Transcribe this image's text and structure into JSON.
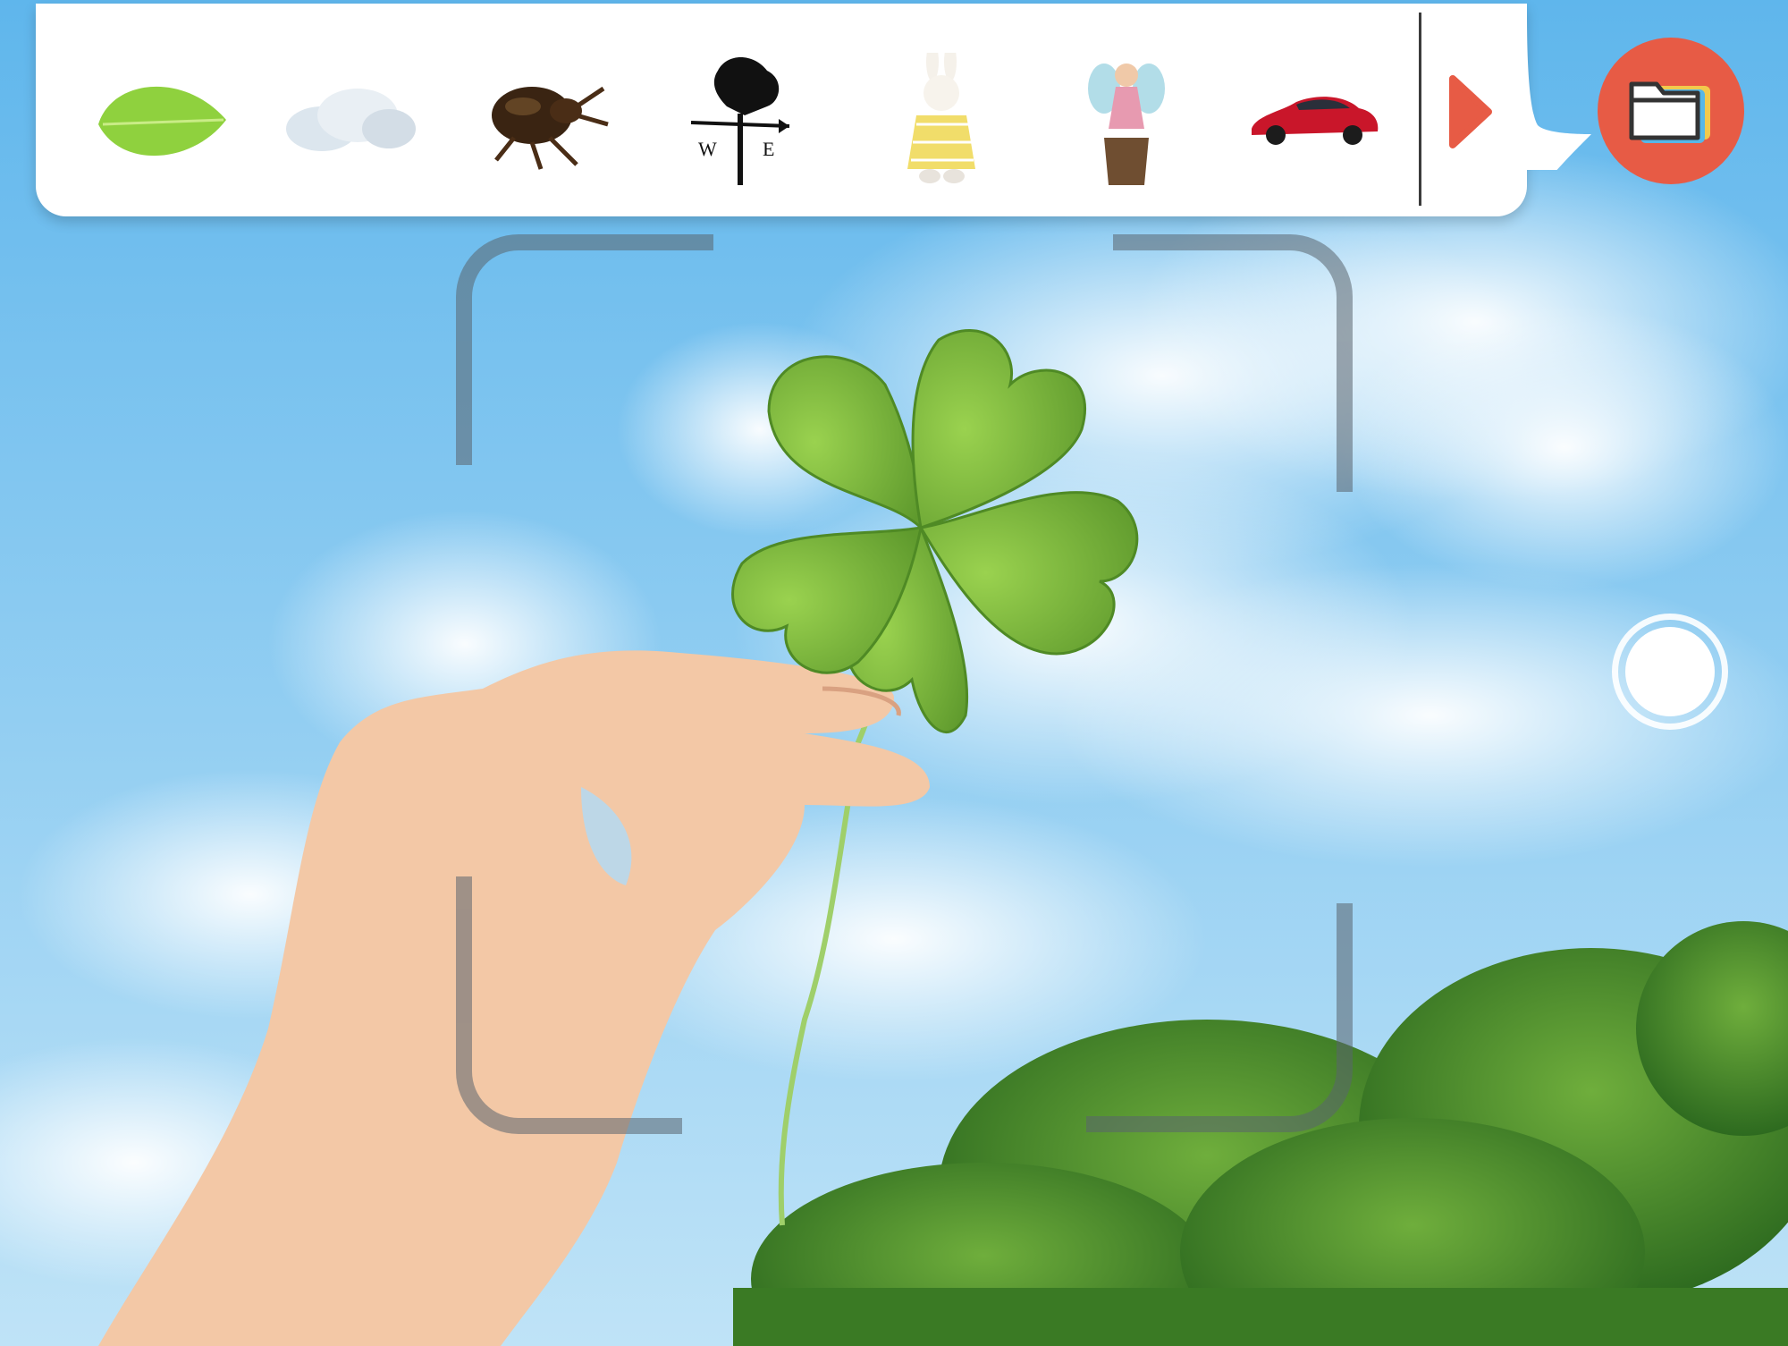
{
  "scene": {
    "description_icon": "four-leaf-clover-photo",
    "sky_top": "#5fb6ec",
    "sky_bottom": "#bfe3f7"
  },
  "tray": {
    "items": [
      {
        "name": "leaf-thumbnail-icon"
      },
      {
        "name": "cloud-thumbnail-icon"
      },
      {
        "name": "beetle-thumbnail-icon"
      },
      {
        "name": "weathervane-thumbnail-icon"
      },
      {
        "name": "rabbit-figurine-thumbnail-icon"
      },
      {
        "name": "fairy-figurine-thumbnail-icon"
      },
      {
        "name": "red-car-thumbnail-icon"
      }
    ],
    "next_icon": "play-arrow-icon",
    "accent": "#e75b45"
  },
  "gallery_button": {
    "icon": "folder-icon",
    "color": "#e75b45"
  },
  "shutter_button": {
    "icon": "shutter-circle-icon"
  },
  "weathervane": {
    "w": "W",
    "e": "E"
  }
}
